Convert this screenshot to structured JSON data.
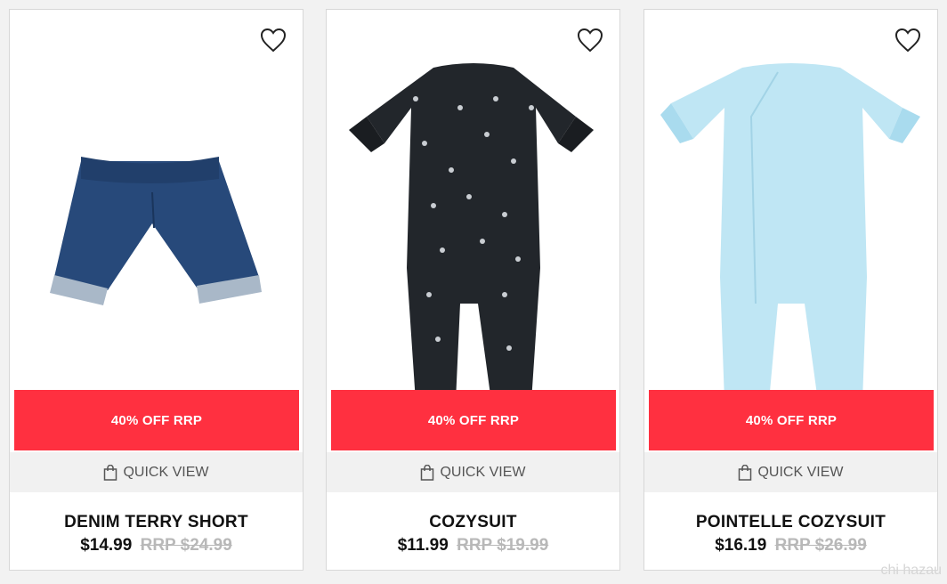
{
  "products": [
    {
      "name": "DENIM TERRY SHORT",
      "price": "$14.99",
      "rrp": "RRP $24.99",
      "badge": "40% OFF RRP",
      "quick_view": "QUICK VIEW",
      "image": "denim-shorts",
      "color": "#27497a"
    },
    {
      "name": "COZYSUIT",
      "price": "$11.99",
      "rrp": "RRP $19.99",
      "badge": "40% OFF RRP",
      "quick_view": "QUICK VIEW",
      "image": "black-star-romper",
      "color": "#22262b"
    },
    {
      "name": "POINTELLE COZYSUIT",
      "price": "$16.19",
      "rrp": "RRP $26.99",
      "badge": "40% OFF RRP",
      "quick_view": "QUICK VIEW",
      "image": "light-blue-romper",
      "color": "#bfe6f4"
    }
  ],
  "icons": {
    "wishlist": "heart-icon",
    "quick_view": "shopping-bag-icon"
  },
  "colors": {
    "badge": "#ff3040",
    "quick_view_bg": "#f1f1f1"
  },
  "watermark": "chi hazau"
}
